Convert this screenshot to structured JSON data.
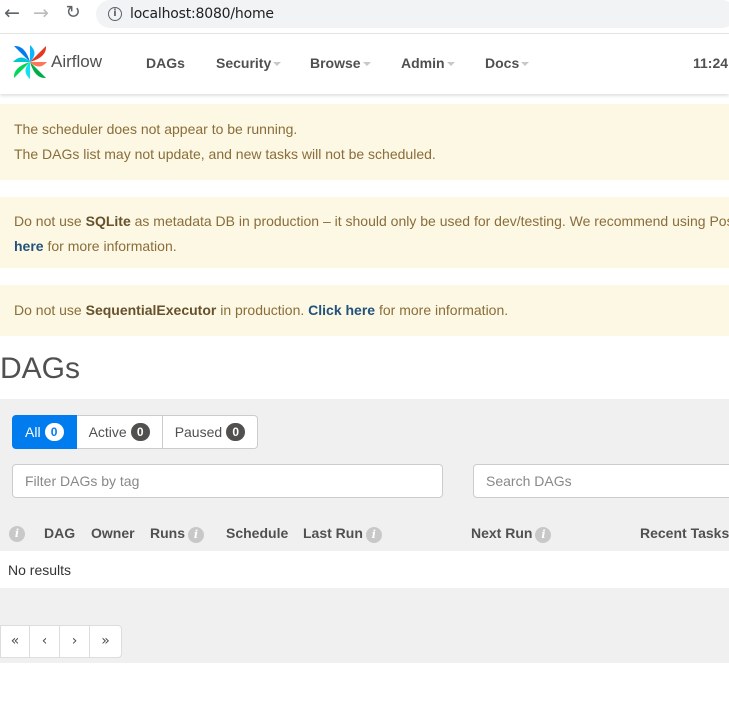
{
  "browser": {
    "back_icon": "arrow-left-icon",
    "forward_icon": "arrow-right-icon",
    "reload_icon": "reload-icon",
    "url": "localhost:8080/home"
  },
  "navbar": {
    "brand": "Airflow",
    "items": [
      {
        "label": "DAGs"
      },
      {
        "label": "Security"
      },
      {
        "label": "Browse"
      },
      {
        "label": "Admin"
      },
      {
        "label": "Docs"
      }
    ],
    "clock": "11:24"
  },
  "alerts": {
    "scheduler": {
      "line1": "The scheduler does not appear to be running.",
      "line2": "The DAGs list may not update, and new tasks will not be scheduled."
    },
    "sqlite": {
      "pre": "Do not use ",
      "bold": "SQLite",
      "mid": " as metadata DB in production – it should only be used for dev/testing. We recommend using Pos",
      "link": "here",
      "post": " for more information."
    },
    "executor": {
      "pre": "Do not use ",
      "bold": "SequentialExecutor",
      "mid": " in production. ",
      "link": "Click here",
      "post": " for more information."
    }
  },
  "page_title": "DAGs",
  "filters": {
    "all": {
      "label": "All",
      "count": "0"
    },
    "active": {
      "label": "Active",
      "count": "0"
    },
    "paused": {
      "label": "Paused",
      "count": "0"
    }
  },
  "tag_filter_placeholder": "Filter DAGs by tag",
  "search_placeholder": "Search DAGs",
  "table": {
    "info_glyph": "i",
    "columns": {
      "dag": "DAG",
      "owner": "Owner",
      "runs": "Runs",
      "schedule": "Schedule",
      "last_run": "Last Run",
      "next_run": "Next Run",
      "recent_tasks": "Recent Tasks"
    },
    "empty_text": "No results"
  },
  "pagination": {
    "first": "«",
    "prev": "‹",
    "next": "›",
    "last": "»"
  },
  "colors": {
    "primary": "#017cee",
    "alert_bg": "#fcf8e3",
    "alert_text": "#8a6d3b",
    "panel_bg": "#f0f0f0"
  }
}
